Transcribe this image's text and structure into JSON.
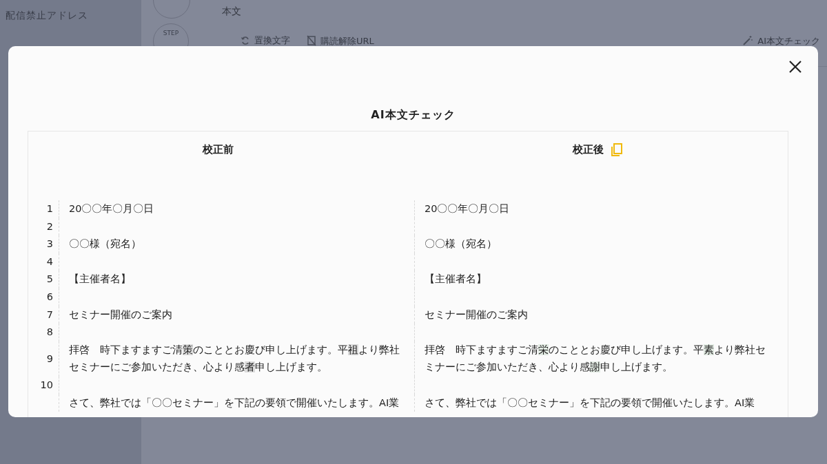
{
  "background": {
    "sidebar": {
      "items": [
        {
          "label": "配信禁止アドレス"
        }
      ]
    },
    "section_label": "本文",
    "step_label": "STEP",
    "toolbar": [
      {
        "kind": "replace",
        "label": "置換文字"
      },
      {
        "kind": "unsubscribe",
        "label": "購読解除URL"
      },
      {
        "kind": "ai",
        "label": "AI本文チェック"
      }
    ]
  },
  "modal": {
    "title": "AI本文チェック",
    "before_heading": "校正前",
    "after_heading": "校正後",
    "rows": [
      {
        "number": "1",
        "before": [
          {
            "text": "20〇〇年〇月〇日",
            "changed": false
          }
        ],
        "after": [
          {
            "text": "20〇〇年〇月〇日",
            "changed": false
          }
        ]
      },
      {
        "number": "2"
      },
      {
        "number": "3",
        "before": [
          {
            "text": "〇〇様（宛名）",
            "changed": false
          }
        ],
        "after": [
          {
            "text": "〇〇様（宛名）",
            "changed": false
          }
        ]
      },
      {
        "number": "4"
      },
      {
        "number": "5",
        "before": [
          {
            "text": "【主催者名】",
            "changed": false
          }
        ],
        "after": [
          {
            "text": "【主催者名】",
            "changed": false
          }
        ]
      },
      {
        "number": "6"
      },
      {
        "number": "7",
        "before": [
          {
            "text": "セミナー開催のご案内",
            "changed": false
          }
        ],
        "after": [
          {
            "text": "セミナー開催のご案内",
            "changed": false
          }
        ]
      },
      {
        "number": "8"
      },
      {
        "number": "9",
        "before": [
          {
            "text": "拝啓　時下ますますご清",
            "changed": false
          },
          {
            "text": "策",
            "changed": true
          },
          {
            "text": "のこととお慶び申し上げます。平",
            "changed": false
          },
          {
            "text": "祖",
            "changed": true
          },
          {
            "text": "より弊社セミナーにご参加いただき、心より感",
            "changed": false
          },
          {
            "text": "者",
            "changed": true
          },
          {
            "text": "申し上げます。",
            "changed": false
          }
        ],
        "after": [
          {
            "text": "拝啓　時下ますますご清",
            "changed": false
          },
          {
            "text": "栄",
            "changed": true
          },
          {
            "text": "のこととお慶び申し上げます。平",
            "changed": false
          },
          {
            "text": "素",
            "changed": true
          },
          {
            "text": "より弊社セミナーにご参加いただき、心より感",
            "changed": false
          },
          {
            "text": "謝",
            "changed": true
          },
          {
            "text": "申し上げます。",
            "changed": false
          }
        ]
      },
      {
        "number": "10"
      },
      {
        "before": [
          {
            "text": "さて、弊社では「〇〇セミナー」を下記の要領で開催いたします。AI業",
            "changed": false
          }
        ],
        "after": [
          {
            "text": "さて、弊社では「〇〇セミナー」を下記の要領で開催いたします。AI業",
            "changed": false
          }
        ]
      }
    ]
  }
}
